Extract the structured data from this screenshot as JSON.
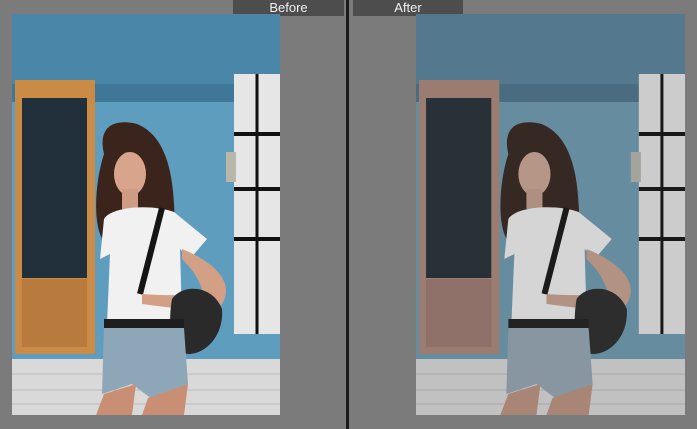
{
  "labels": {
    "before": "Before",
    "after": "After"
  },
  "colors": {
    "background": "#7b7b7b",
    "label_bg": "#4d4d4d",
    "label_text": "#f0f0f0",
    "divider": "#1a1a1a",
    "wall_blue": "#5e9ec0",
    "door_orange": "#c98b45",
    "door_after": "#b68571"
  }
}
